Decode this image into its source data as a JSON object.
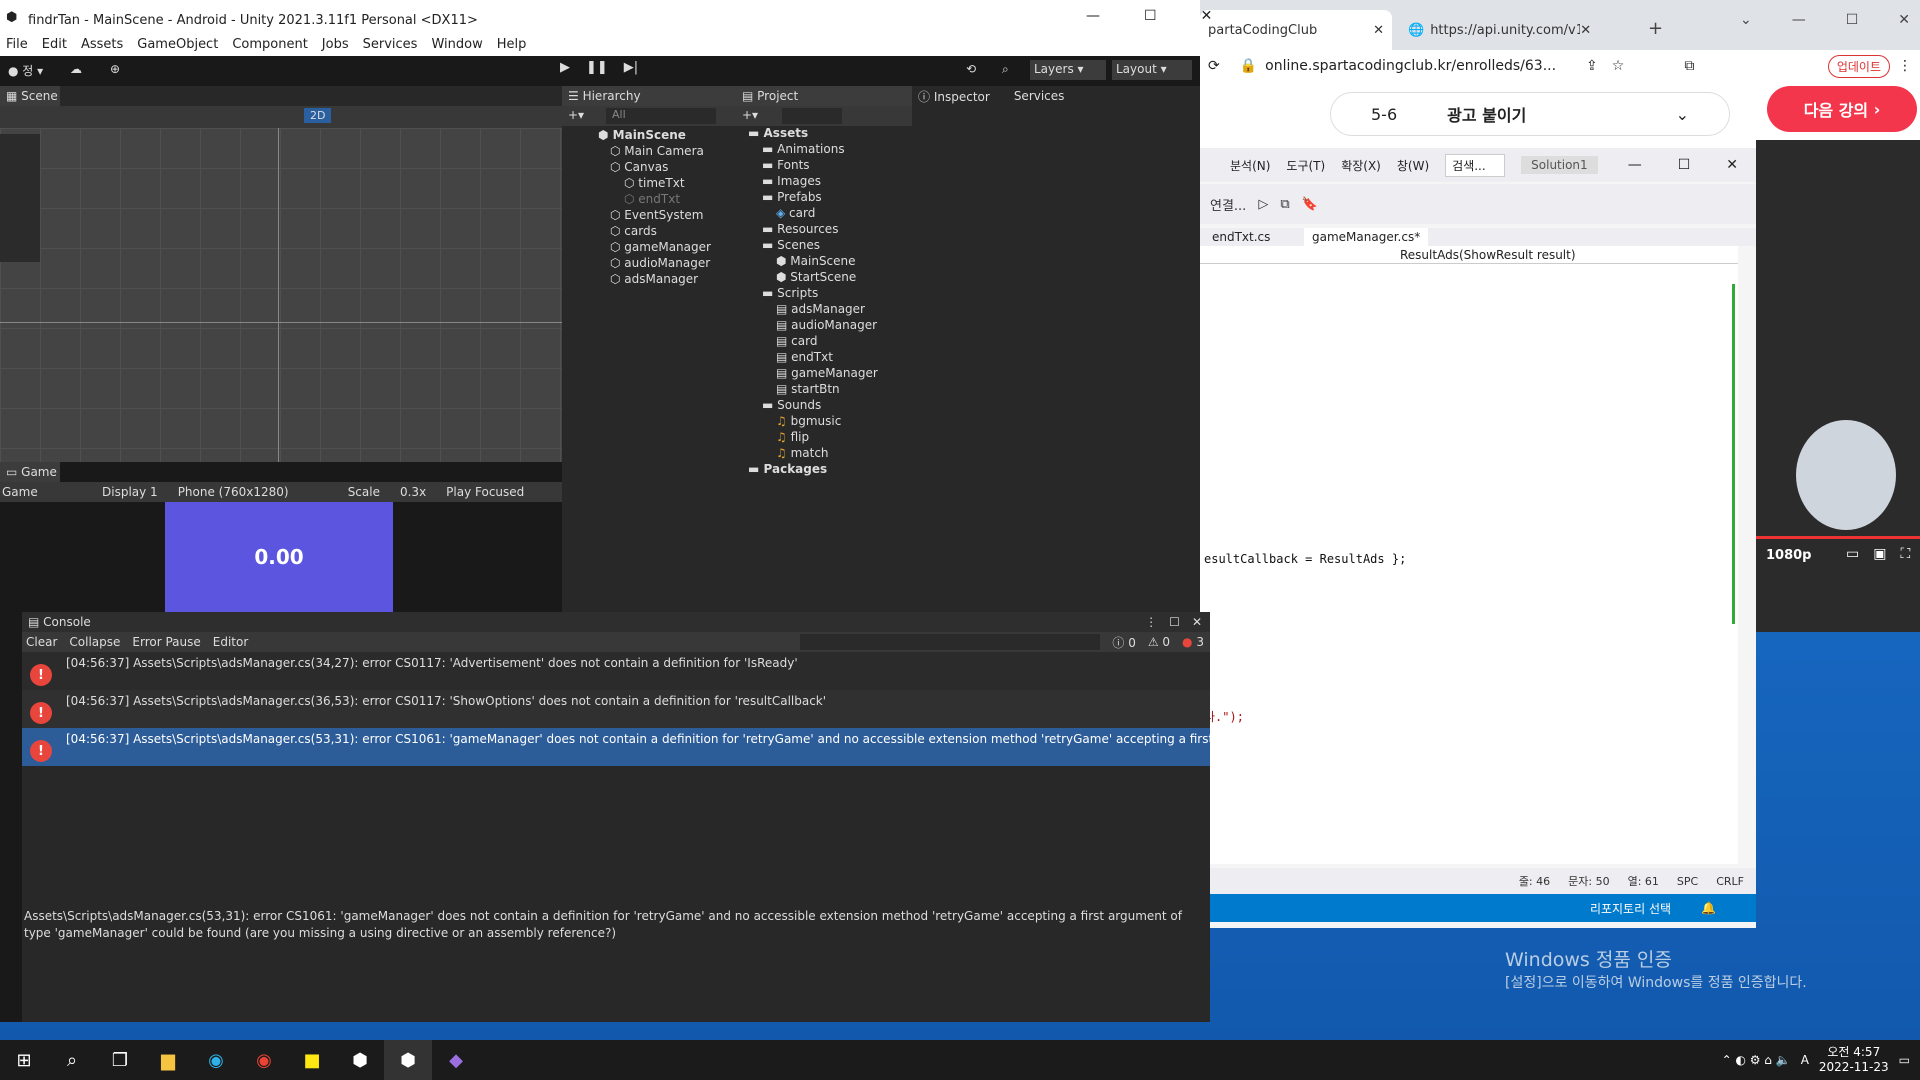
{
  "unity": {
    "title": "findrTan - MainScene - Android - Unity 2021.3.11f1 Personal <DX11>",
    "menu": [
      "File",
      "Edit",
      "Assets",
      "GameObject",
      "Component",
      "Jobs",
      "Services",
      "Window",
      "Help"
    ],
    "toolbar": {
      "account_label": "정",
      "layers": "Layers",
      "layout": "Layout"
    },
    "scene_tab": "Scene",
    "scene_toggle": "2D",
    "hierarchy": {
      "tab": "Hierarchy",
      "search_placeholder": "All",
      "root": "MainScene",
      "items": [
        {
          "label": "Main Camera",
          "level": 1,
          "dim": false
        },
        {
          "label": "Canvas",
          "level": 1,
          "dim": false
        },
        {
          "label": "timeTxt",
          "level": 2,
          "dim": false
        },
        {
          "label": "endTxt",
          "level": 2,
          "dim": true
        },
        {
          "label": "EventSystem",
          "level": 1,
          "dim": false
        },
        {
          "label": "cards",
          "level": 1,
          "dim": false
        },
        {
          "label": "gameManager",
          "level": 1,
          "dim": false
        },
        {
          "label": "audioManager",
          "level": 1,
          "dim": false
        },
        {
          "label": "adsManager",
          "level": 1,
          "dim": false
        }
      ]
    },
    "project": {
      "tab": "Project",
      "items": [
        {
          "label": "Assets",
          "level": 0,
          "type": "folder",
          "bold": true
        },
        {
          "label": "Animations",
          "level": 1,
          "type": "folder"
        },
        {
          "label": "Fonts",
          "level": 1,
          "type": "folder"
        },
        {
          "label": "Images",
          "level": 1,
          "type": "folder"
        },
        {
          "label": "Prefabs",
          "level": 1,
          "type": "folder"
        },
        {
          "label": "card",
          "level": 2,
          "type": "prefab"
        },
        {
          "label": "Resources",
          "level": 1,
          "type": "folder"
        },
        {
          "label": "Scenes",
          "level": 1,
          "type": "folder"
        },
        {
          "label": "MainScene",
          "level": 2,
          "type": "scene"
        },
        {
          "label": "StartScene",
          "level": 2,
          "type": "scene"
        },
        {
          "label": "Scripts",
          "level": 1,
          "type": "folder"
        },
        {
          "label": "adsManager",
          "level": 2,
          "type": "script"
        },
        {
          "label": "audioManager",
          "level": 2,
          "type": "script"
        },
        {
          "label": "card",
          "level": 2,
          "type": "script"
        },
        {
          "label": "endTxt",
          "level": 2,
          "type": "script"
        },
        {
          "label": "gameManager",
          "level": 2,
          "type": "script"
        },
        {
          "label": "startBtn",
          "level": 2,
          "type": "script"
        },
        {
          "label": "Sounds",
          "level": 1,
          "type": "folder"
        },
        {
          "label": "bgmusic",
          "level": 2,
          "type": "audio"
        },
        {
          "label": "flip",
          "level": 2,
          "type": "audio"
        },
        {
          "label": "match",
          "level": 2,
          "type": "audio"
        },
        {
          "label": "Packages",
          "level": 0,
          "type": "folder",
          "bold": true
        }
      ]
    },
    "inspector": {
      "tab": "Inspector",
      "services_tab": "Services"
    },
    "game": {
      "tab": "Game",
      "mode": "Game",
      "display": "Display 1",
      "resolution": "Phone (760x1280)",
      "scale_label": "Scale",
      "scale_value": "0.3x",
      "play_mode": "Play Focused",
      "timer": "0.00",
      "timer_bg": "#5b55e0"
    },
    "console": {
      "tab": "Console",
      "buttons": [
        "Clear",
        "Collapse",
        "Error Pause",
        "Editor"
      ],
      "counts": {
        "log": "0",
        "warn": "0",
        "error": "3"
      },
      "errors": [
        "[04:56:37] Assets\\Scripts\\adsManager.cs(34,27): error CS0117: 'Advertisement' does not contain a definition for 'IsReady'",
        "[04:56:37] Assets\\Scripts\\adsManager.cs(36,53): error CS0117: 'ShowOptions' does not contain a definition for 'resultCallback'",
        "[04:56:37] Assets\\Scripts\\adsManager.cs(53,31): error CS1061: 'gameManager' does not contain a definition for 'retryGame' and no accessible extension method 'retryGame' accepting a first argument of typ"
      ],
      "detail": "Assets\\Scripts\\adsManager.cs(53,31): error CS1061: 'gameManager' does not contain a definition for 'retryGame' and no accessible extension method 'retryGame' accepting a first argument of type 'gameManager' could be found (are you missing a using directive or an assembly reference?)"
    }
  },
  "browser": {
    "tab1": "partaCodingClub",
    "tab2": "https://api.unity.com/v1/oauth2",
    "url": "online.spartacodingclub.kr/enrolleds/63...",
    "update_btn": "업데이트",
    "lesson_num": "5-6",
    "lesson_title": "광고 붙이기",
    "next_btn": "다음 강의",
    "quality": "1080p"
  },
  "vs": {
    "menu": [
      "분석(N)",
      "도구(T)",
      "확장(X)",
      "창(W)"
    ],
    "search": "검색...",
    "solution": "Solution1",
    "tab1": "endTxt.cs",
    "tab2": "gameManager.cs*",
    "method": "ResultAds(ShowResult result)",
    "code_line1": "esultCallback = ResultAds };",
    "code_line2": "다.\");",
    "status": {
      "line": "줄: 46",
      "char": "문자: 50",
      "col": "열: 61",
      "spc": "SPC",
      "crlf": "CRLF"
    },
    "repo": "리포지토리 선택"
  },
  "watermark": {
    "line1": "Windows 정품 인증",
    "line2": "[설정]으로 이동하여 Windows를 정품 인증합니다."
  },
  "taskbar": {
    "time": "오전 4:57",
    "date": "2022-11-23",
    "lang": "A"
  }
}
